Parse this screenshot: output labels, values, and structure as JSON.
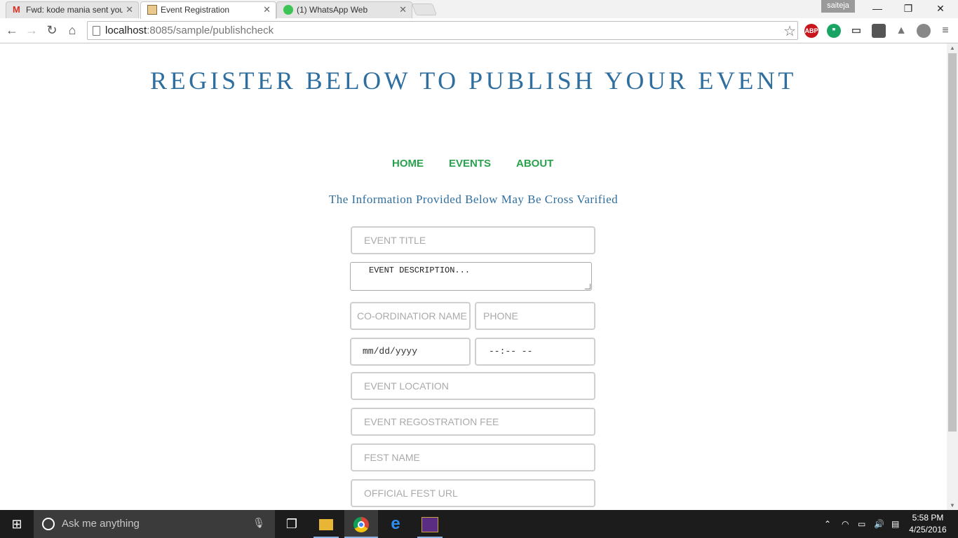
{
  "browser": {
    "tabs": [
      {
        "label": "Fwd: kode mania sent you",
        "active": false
      },
      {
        "label": "Event Registration",
        "active": true
      },
      {
        "label": "(1) WhatsApp Web",
        "active": false
      }
    ],
    "profile": "saiteja",
    "url_host": "localhost",
    "url_path": ":8085/sample/publishcheck",
    "extensions": [
      "ABP"
    ]
  },
  "page": {
    "title": "REGISTER BELOW TO PUBLISH YOUR EVENT",
    "nav": [
      "HOME",
      "EVENTS",
      "ABOUT"
    ],
    "subtitle": "The Information Provided Below May Be Cross Varified",
    "form": {
      "event_title": "EVENT TITLE",
      "event_description": "EVENT DESCRIPTION...",
      "coordinator_name": "CO-ORDINATIOR NAME",
      "phone": "PHONE",
      "date": "mm/dd/yyyy",
      "time": "--:-- --",
      "event_location": "EVENT LOCATION",
      "registration_fee": "EVENT REGOSTRATION FEE",
      "fest_name": "FEST NAME",
      "fest_url": "OFFICIAL FEST URL"
    }
  },
  "taskbar": {
    "search_placeholder": "Ask me anything",
    "time": "5:58 PM",
    "date": "4/25/2016"
  },
  "colors": {
    "title": "#2f6fa0",
    "nav": "#2aa14d"
  }
}
